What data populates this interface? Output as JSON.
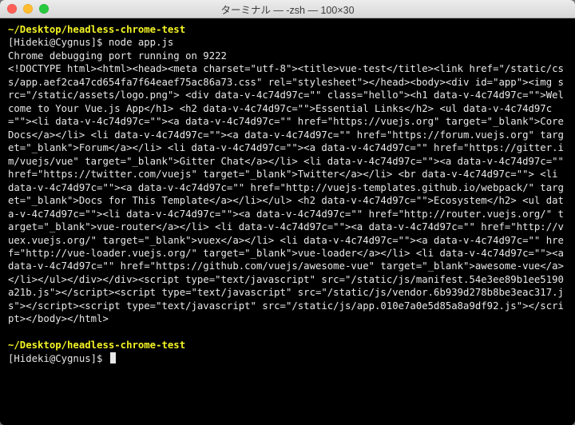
{
  "window": {
    "title": "ターミナル — -zsh — 100×30"
  },
  "prompt1": {
    "path": "~/Desktop/headless-chrome-test",
    "user": "[Hideki@Cygnus]$ ",
    "cmd": "node app.js"
  },
  "out": {
    "running": "Chrome debugging port running on 9222",
    "html": "<!DOCTYPE html><html><head><meta charset=\"utf-8\"><title>vue-test</title><link href=\"/static/css/app.aef2ca47cd654fa7f64eaef75ac86a73.css\" rel=\"stylesheet\"></head><body><div id=\"app\"><img src=\"/static/assets/logo.png\"> <div data-v-4c74d97c=\"\" class=\"hello\"><h1 data-v-4c74d97c=\"\">Welcome to Your Vue.js App</h1> <h2 data-v-4c74d97c=\"\">Essential Links</h2> <ul data-v-4c74d97c=\"\"><li data-v-4c74d97c=\"\"><a data-v-4c74d97c=\"\" href=\"https://vuejs.org\" target=\"_blank\">Core Docs</a></li> <li data-v-4c74d97c=\"\"><a data-v-4c74d97c=\"\" href=\"https://forum.vuejs.org\" target=\"_blank\">Forum</a></li> <li data-v-4c74d97c=\"\"><a data-v-4c74d97c=\"\" href=\"https://gitter.im/vuejs/vue\" target=\"_blank\">Gitter Chat</a></li> <li data-v-4c74d97c=\"\"><a data-v-4c74d97c=\"\" href=\"https://twitter.com/vuejs\" target=\"_blank\">Twitter</a></li> <br data-v-4c74d97c=\"\"> <li data-v-4c74d97c=\"\"><a data-v-4c74d97c=\"\" href=\"http://vuejs-templates.github.io/webpack/\" target=\"_blank\">Docs for This Template</a></li></ul> <h2 data-v-4c74d97c=\"\">Ecosystem</h2> <ul data-v-4c74d97c=\"\"><li data-v-4c74d97c=\"\"><a data-v-4c74d97c=\"\" href=\"http://router.vuejs.org/\" target=\"_blank\">vue-router</a></li> <li data-v-4c74d97c=\"\"><a data-v-4c74d97c=\"\" href=\"http://vuex.vuejs.org/\" target=\"_blank\">vuex</a></li> <li data-v-4c74d97c=\"\"><a data-v-4c74d97c=\"\" href=\"http://vue-loader.vuejs.org/\" target=\"_blank\">vue-loader</a></li> <li data-v-4c74d97c=\"\"><a data-v-4c74d97c=\"\" href=\"https://github.com/vuejs/awesome-vue\" target=\"_blank\">awesome-vue</a></li></ul></div></div><script type=\"text/javascript\" src=\"/static/js/manifest.54e3ee89b1ee5190a21b.js\"></script><script type=\"text/javascript\" src=\"/static/js/vendor.6b939d278b8be3eac317.js\"></script><script type=\"text/javascript\" src=\"/static/js/app.010e7a0e5d85a8a9df92.js\"></script></body></html>"
  },
  "prompt2": {
    "path": "~/Desktop/headless-chrome-test",
    "user": "[Hideki@Cygnus]$ "
  }
}
